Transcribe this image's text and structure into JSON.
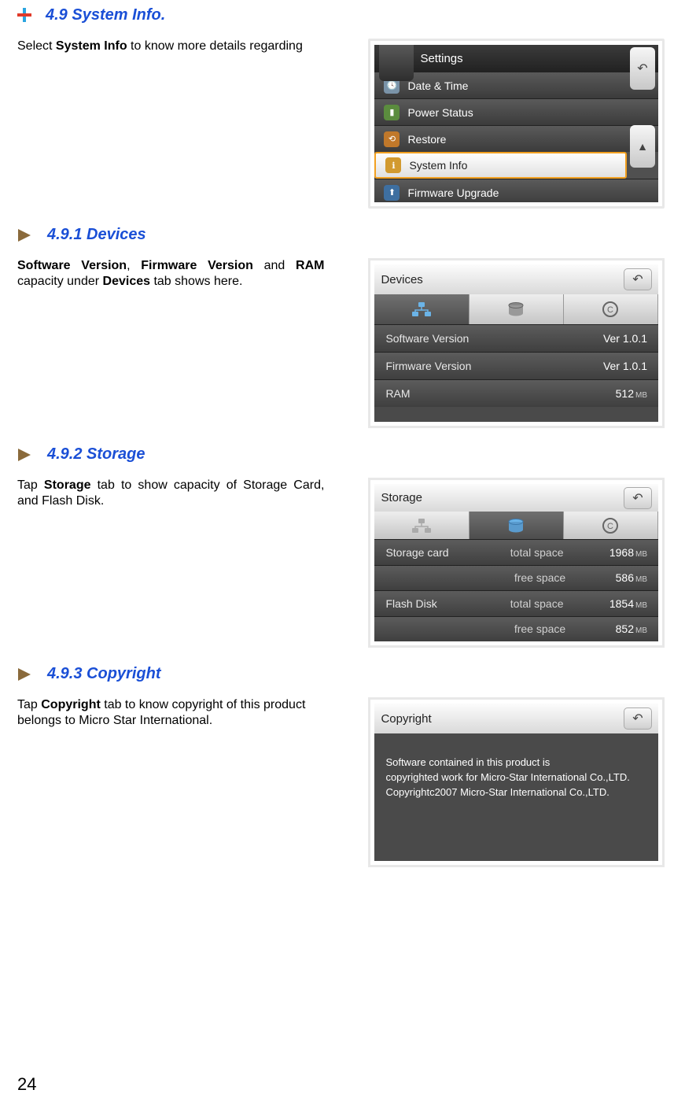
{
  "section": {
    "title": "4.9 System Info.",
    "intro_pre": "Select ",
    "intro_bold": "System Info",
    "intro_post": " to know more details regarding"
  },
  "figA": {
    "header": "Settings",
    "items": [
      "Date & Time",
      "Power Status",
      "Restore",
      "System Info",
      "Firmware Upgrade"
    ],
    "back": "↶"
  },
  "sub1": {
    "title": "4.9.1 Devices",
    "t0": "Software Version",
    "t1": ", ",
    "t2": "Firmware Version",
    "t3": " and ",
    "t4": "RAM",
    "t5": " capacity under ",
    "t6": "Devices",
    "t7": " tab shows here."
  },
  "figB": {
    "head": "Devices",
    "rows": [
      {
        "label": "Software Version",
        "value": "Ver 1.0.1",
        "unit": ""
      },
      {
        "label": "Firmware Version",
        "value": "Ver 1.0.1",
        "unit": ""
      },
      {
        "label": "RAM",
        "value": "512",
        "unit": "MB"
      }
    ]
  },
  "sub2": {
    "title": "4.9.2 Storage",
    "t0": "Tap ",
    "t1": "Storage",
    "t2": " tab to show capacity of Storage Card, and Flash Disk."
  },
  "figC": {
    "head": "Storage",
    "rows": [
      {
        "l": "Storage card",
        "m": "total space",
        "v": "1968",
        "u": "MB"
      },
      {
        "l": "",
        "m": "free space",
        "v": "586",
        "u": "MB"
      },
      {
        "l": "Flash Disk",
        "m": "total space",
        "v": "1854",
        "u": "MB"
      },
      {
        "l": "",
        "m": "free space",
        "v": "852",
        "u": "MB"
      }
    ]
  },
  "sub3": {
    "title": "4.9.3 Copyright",
    "t0": "Tap ",
    "t1": "Copyright",
    "t2": " tab to know copyright of this product belongs to Micro Star International."
  },
  "figD": {
    "head": "Copyright",
    "line1": "Software contained in this product is",
    "line2": "copyrighted work for Micro-Star International Co.,LTD.",
    "line3": "Copyrightc2007 Micro-Star International Co.,LTD."
  },
  "page": "24"
}
